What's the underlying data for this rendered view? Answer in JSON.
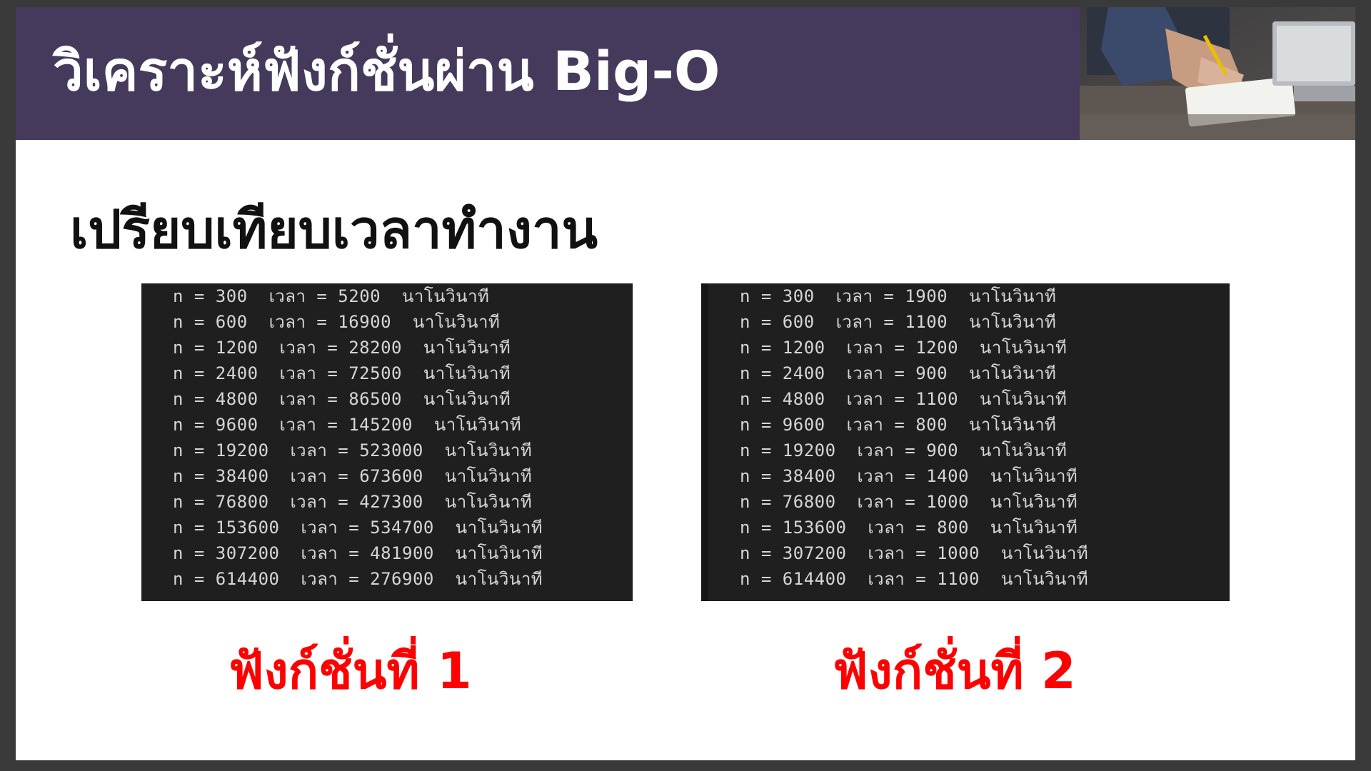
{
  "header": {
    "title": "วิเคราะห์ฟังก์ชั่นผ่าน Big-O"
  },
  "subtitle": "เปรียบเทียบเวลาทำงาน",
  "consoles": [
    {
      "caption": "ฟังก์ชั่นที่ 1",
      "rows": [
        {
          "n": "300",
          "time": "5200"
        },
        {
          "n": "600",
          "time": "16900"
        },
        {
          "n": "1200",
          "time": "28200"
        },
        {
          "n": "2400",
          "time": "72500"
        },
        {
          "n": "4800",
          "time": "86500"
        },
        {
          "n": "9600",
          "time": "145200"
        },
        {
          "n": "19200",
          "time": "523000"
        },
        {
          "n": "38400",
          "time": "673600"
        },
        {
          "n": "76800",
          "time": "427300"
        },
        {
          "n": "153600",
          "time": "534700"
        },
        {
          "n": "307200",
          "time": "481900"
        },
        {
          "n": "614400",
          "time": "276900"
        }
      ]
    },
    {
      "caption": "ฟังก์ชั่นที่ 2",
      "rows": [
        {
          "n": "300",
          "time": "1900"
        },
        {
          "n": "600",
          "time": "1100"
        },
        {
          "n": "1200",
          "time": "1200"
        },
        {
          "n": "2400",
          "time": "900"
        },
        {
          "n": "4800",
          "time": "1100"
        },
        {
          "n": "9600",
          "time": "800"
        },
        {
          "n": "19200",
          "time": "900"
        },
        {
          "n": "38400",
          "time": "1400"
        },
        {
          "n": "76800",
          "time": "1000"
        },
        {
          "n": "153600",
          "time": "800"
        },
        {
          "n": "307200",
          "time": "1000"
        },
        {
          "n": "614400",
          "time": "1100"
        }
      ]
    }
  ],
  "console_labels": {
    "n_prefix": "n = ",
    "time_word": "เวลา",
    "unit": "นาโนวินาที"
  },
  "colors": {
    "header_bg": "#453a5c",
    "caption": "#ff0000",
    "console_bg": "#1f1f1f"
  }
}
